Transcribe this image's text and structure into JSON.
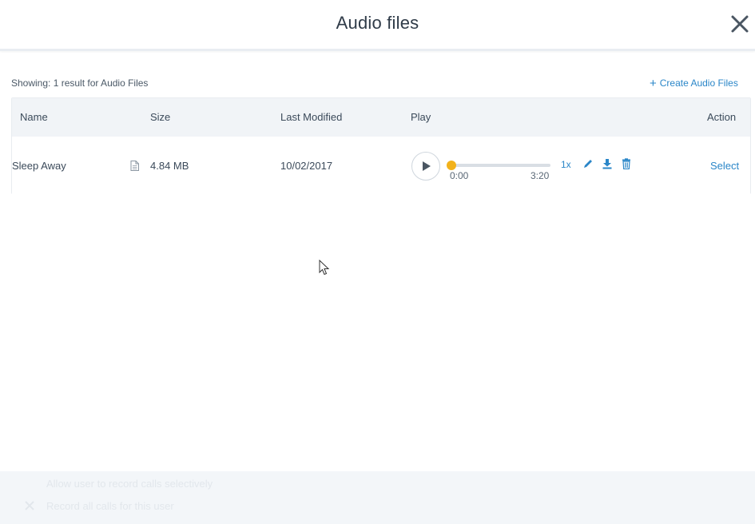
{
  "modal": {
    "title": "Audio files"
  },
  "summary": {
    "text": "Showing: 1 result for Audio Files",
    "create_label": "Create Audio Files"
  },
  "table": {
    "headers": {
      "name": "Name",
      "size": "Size",
      "modified": "Last Modified",
      "play": "Play",
      "action": "Action"
    },
    "rows": [
      {
        "name": "Sleep Away",
        "size": "4.84 MB",
        "modified": "10/02/2017",
        "current_time": "0:00",
        "duration": "3:20",
        "progress": 0,
        "speed": "1x",
        "action": "Select"
      }
    ]
  },
  "footer": {
    "line1": "Allow user to record calls selectively",
    "line2": "Record all calls for this user"
  },
  "colors": {
    "accent": "#2a86c8",
    "progress_knob": "#f2b21b",
    "header_bg": "#f1f4f7"
  },
  "icons": {
    "close": "close-icon",
    "file": "file-icon",
    "play": "play-icon",
    "edit": "pencil-icon",
    "download": "download-icon",
    "delete": "trash-icon"
  }
}
